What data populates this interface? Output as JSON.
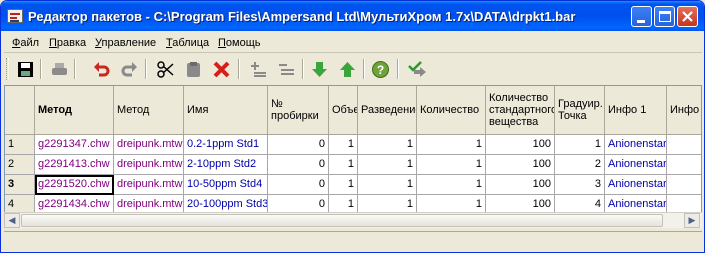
{
  "window": {
    "title": "Редактор пакетов - C:\\Program Files\\Ampersand Ltd\\МультиХром 1.7x\\DATA\\drpkt1.bar"
  },
  "menu": [
    {
      "u": "Ф",
      "rest": "айл"
    },
    {
      "u": "П",
      "rest": "равка"
    },
    {
      "u": "У",
      "rest": "правление"
    },
    {
      "u": "Т",
      "rest": "аблица"
    },
    {
      "u": "П",
      "rest": "омощь"
    }
  ],
  "toolbar_icons": [
    "save-icon",
    "print-icon",
    "undo-icon",
    "redo-icon",
    "cut-icon",
    "paste-icon",
    "delete-icon",
    "insert-row-icon",
    "delete-row-icon",
    "move-down-icon",
    "move-up-icon",
    "help-icon",
    "apply-icon"
  ],
  "table": {
    "columns": [
      "Метод",
      "Метод",
      "Имя",
      "№ пробирки",
      "Объем",
      "Разведение",
      "Количество",
      "Количество стандартного вещества",
      "Градуир. Точка",
      "Инфо 1",
      "Инфо"
    ],
    "rows": [
      {
        "n": "1",
        "cells": [
          "g2291347.chw",
          "dreipunk.mtw",
          "0.2-1ppm Std1",
          "0",
          "1",
          "1",
          "1",
          "100",
          "1",
          "Anionenstar",
          ""
        ]
      },
      {
        "n": "2",
        "cells": [
          "g2291413.chw",
          "dreipunk.mtw",
          "2-10ppm Std2",
          "0",
          "1",
          "1",
          "1",
          "100",
          "2",
          "Anionenstar",
          ""
        ]
      },
      {
        "n": "3",
        "cells": [
          "g2291520.chw",
          "dreipunk.mtw",
          "10-50ppm Std4",
          "0",
          "1",
          "1",
          "1",
          "100",
          "3",
          "Anionenstar",
          ""
        ]
      },
      {
        "n": "4",
        "cells": [
          "g2291434.chw",
          "dreipunk.mtw",
          "20-100ppm Std3",
          "0",
          "1",
          "1",
          "1",
          "100",
          "4",
          "Anionenstar",
          ""
        ]
      }
    ],
    "active_row": 3
  },
  "status": {
    "text": ""
  },
  "colors": {
    "title_bar": "#0054e3",
    "method_text": "#800080",
    "name_text": "#0000aa"
  }
}
